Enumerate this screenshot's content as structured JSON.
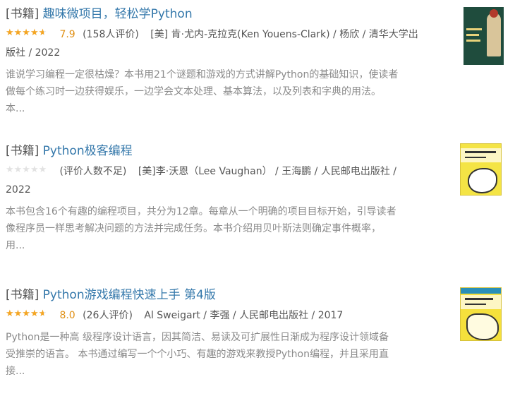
{
  "results": [
    {
      "category": "[书籍]",
      "title": "趣味微项目，轻松学Python",
      "stars_glyphs": "★★★★★",
      "rating_fraction": 0.8,
      "score": "7.9",
      "votes": "(158人评价)",
      "pub_line1": "[美] 肯·尤内-克拉克(Ken Youens-Clark) / 杨欣 / 清华大学出",
      "pub_line2": "版社 / 2022",
      "abstract_lines": [
        "谁说学习编程一定很枯燥？本书用21个谜题和游戏的方式讲解Python的基础知识，使读者",
        "做每个练习时一边获得娱乐，一边学会文本处理、基本算法，以及列表和字典的用法。",
        "本..."
      ]
    },
    {
      "category": "[书籍]",
      "title": "Python极客编程",
      "stars_glyphs": "★★★★★",
      "rating_fraction": 0,
      "score": "",
      "votes": "(评价人数不足)",
      "pub_line1": "[美]李·沃恩（Lee Vaughan） / 王海鹏 / 人民邮电出版社 /",
      "pub_line2": "2022",
      "abstract_lines": [
        "本书包含16个有趣的编程项目，共分为12章。每章从一个明确的项目目标开始，引导读者",
        "像程序员一样思考解决问题的方法并完成任务。本书介绍用贝叶斯法则确定事件概率，",
        "用..."
      ]
    },
    {
      "category": "[书籍]",
      "title": "Python游戏编程快速上手 第4版",
      "stars_glyphs": "★★★★★",
      "rating_fraction": 0.8,
      "score": "8.0",
      "votes": "(26人评价)",
      "pub_line1": "Al Sweigart / 李强 / 人民邮电出版社 / 2017",
      "pub_line2": "",
      "abstract_lines": [
        "Python是一种高 级程序设计语言，因其简洁、易读及可扩展性日渐成为程序设计领域备",
        "受推崇的语言。 本书通过编写一个个小巧、有趣的游戏来教授Python编程，并且采用直",
        "接..."
      ]
    }
  ],
  "colors": {
    "link": "#3377aa",
    "star": "#f5a623",
    "score": "#e09015",
    "abstract": "#8a8a8a"
  }
}
